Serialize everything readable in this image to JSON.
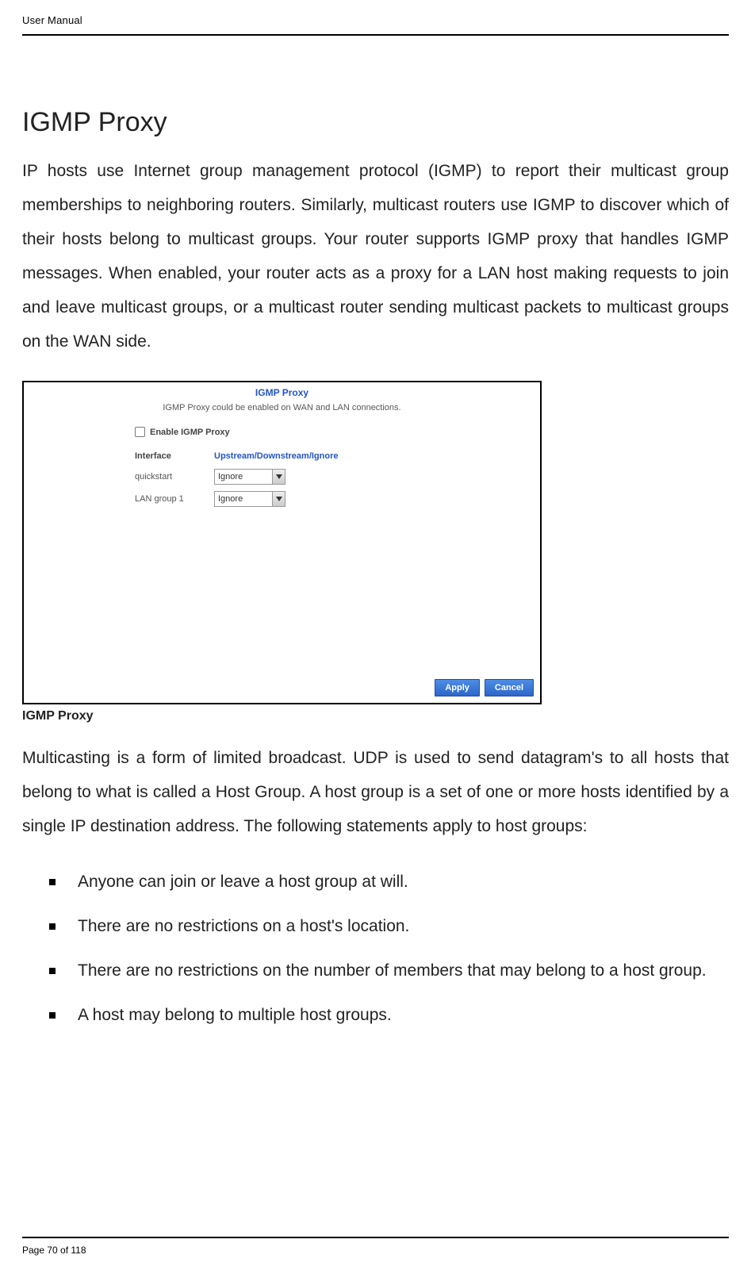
{
  "header": {
    "doc_title": "User Manual"
  },
  "section": {
    "title": "IGMP Proxy",
    "intro": "IP hosts use Internet group management protocol (IGMP) to report their multicast group memberships to neighboring routers. Similarly, multicast routers use IGMP to discover which of their hosts belong to multicast groups. Your router supports IGMP proxy that handles IGMP messages. When enabled, your router acts as a proxy for a LAN host making requests to join and leave multicast groups, or a multicast router sending multicast packets to multicast groups on the WAN side."
  },
  "screenshot": {
    "title": "IGMP Proxy",
    "subtitle": "IGMP Proxy could be enabled on WAN and LAN connections.",
    "enable_label": "Enable IGMP Proxy",
    "col_left": "Interface",
    "col_right": "Upstream/Downstream/Ignore",
    "rows": [
      {
        "label": "quickstart",
        "value": "Ignore"
      },
      {
        "label": "LAN group 1",
        "value": "Ignore"
      }
    ],
    "apply": "Apply",
    "cancel": "Cancel"
  },
  "caption": "IGMP Proxy",
  "para2": "Multicasting is a form of limited broadcast. UDP is used to send datagram's to all hosts that belong to what is called a Host Group. A host group is a set of one or more hosts identified by a single IP destination address. The following statements apply to host groups:",
  "bullets": [
    "Anyone can join or leave a host group at will.",
    "There are no restrictions on a host's location.",
    "There are no restrictions on the number of members that may belong to a host group.",
    "A host may belong to multiple host groups."
  ],
  "footer": {
    "page": "Page 70 of 118"
  }
}
